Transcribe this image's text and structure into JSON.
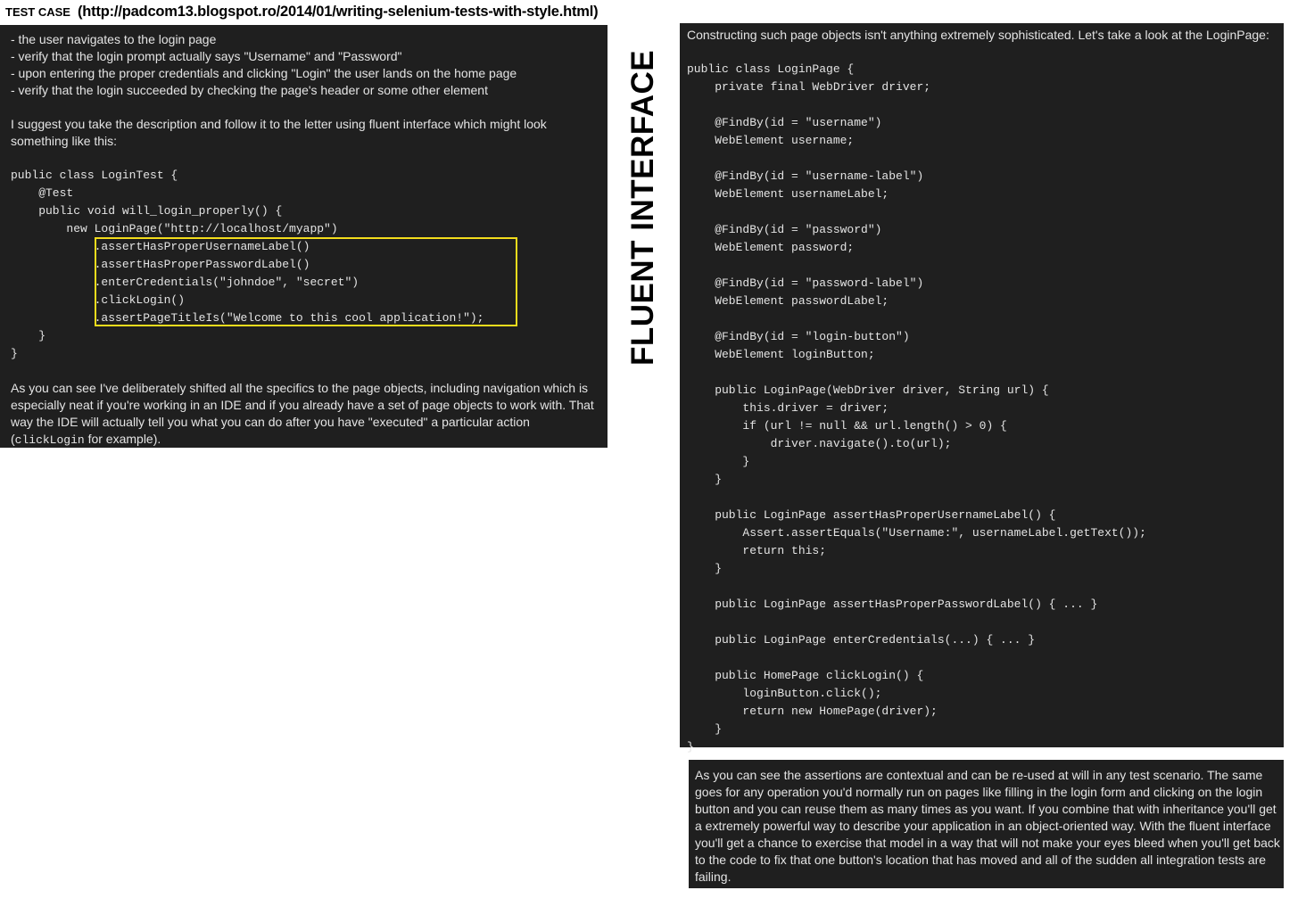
{
  "header": {
    "label": "TEST CASE",
    "url": "(http://padcom13.blogspot.ro/2014/01/writing-selenium-tests-with-style.html)"
  },
  "side_title": "FLUENT INTERFACE",
  "left_panel": {
    "bullets": [
      "- the user navigates to the login page",
      "- verify that the login prompt actually says \"Username\" and \"Password\"",
      "- upon entering the proper credentials and clicking \"Login\" the user lands on the home page",
      "- verify that the login succeeded by checking the page's header or some other element"
    ],
    "intro": "I suggest you take the description and follow it to the letter using fluent interface which might look something like this:",
    "code_before": "public class LoginTest {\n    @Test\n    public void will_login_properly() {\n        new LoginPage(\"http://localhost/myapp\")",
    "code_highlighted": "            .assertHasProperUsernameLabel()\n            .assertHasProperPasswordLabel()\n            .enterCredentials(\"johndoe\", \"secret\")\n            .clickLogin()\n            .assertPageTitleIs(\"Welcome to this cool application!\");",
    "code_after": "    }\n}",
    "outro": "As you can see I've deliberately shifted all the specifics to the page objects, including navigation which is especially neat if you're working in an IDE and if you already have a set of page objects to work with. That way the IDE will actually tell you what you can do after you have \"executed\" a particular action (",
    "outro_code": "clickLogin",
    "outro_end": " for example)."
  },
  "right_panel": {
    "intro": "Constructing such page objects isn't anything extremely sophisticated. Let's take a look at the LoginPage:",
    "code": "public class LoginPage {\n    private final WebDriver driver;\n\n    @FindBy(id = \"username\")\n    WebElement username;\n\n    @FindBy(id = \"username-label\")\n    WebElement usernameLabel;\n\n    @FindBy(id = \"password\")\n    WebElement password;\n\n    @FindBy(id = \"password-label\")\n    WebElement passwordLabel;\n\n    @FindBy(id = \"login-button\")\n    WebElement loginButton;\n\n    public LoginPage(WebDriver driver, String url) {\n        this.driver = driver;\n        if (url != null && url.length() > 0) {\n            driver.navigate().to(url);\n        }\n    }\n\n    public LoginPage assertHasProperUsernameLabel() {\n        Assert.assertEquals(\"Username:\", usernameLabel.getText());\n        return this;\n    }\n\n    public LoginPage assertHasProperPasswordLabel() { ... }\n\n    public LoginPage enterCredentials(...) { ... }\n\n    public HomePage clickLogin() {\n        loginButton.click();\n        return new HomePage(driver);\n    }\n}"
  },
  "bottom_panel": {
    "text": "As you can see the assertions are contextual and can be re-used at will in any test scenario. The same goes for any operation you'd normally run on pages like filling in the login form and clicking on the login button and you can reuse them as many times as you want. If you combine that with inheritance you'll get a extremely powerful way to describe your application in an object-oriented way. With the fluent interface you'll get a chance to exercise that model in a way that will not make your eyes bleed when you'll get back to the code to fix that one button's location that has moved and all of the sudden all integration tests are failing."
  },
  "colors": {
    "panel_bg": "#1f1f1f",
    "panel_text": "#e4e4e4",
    "highlight": "#f2dc1c"
  }
}
